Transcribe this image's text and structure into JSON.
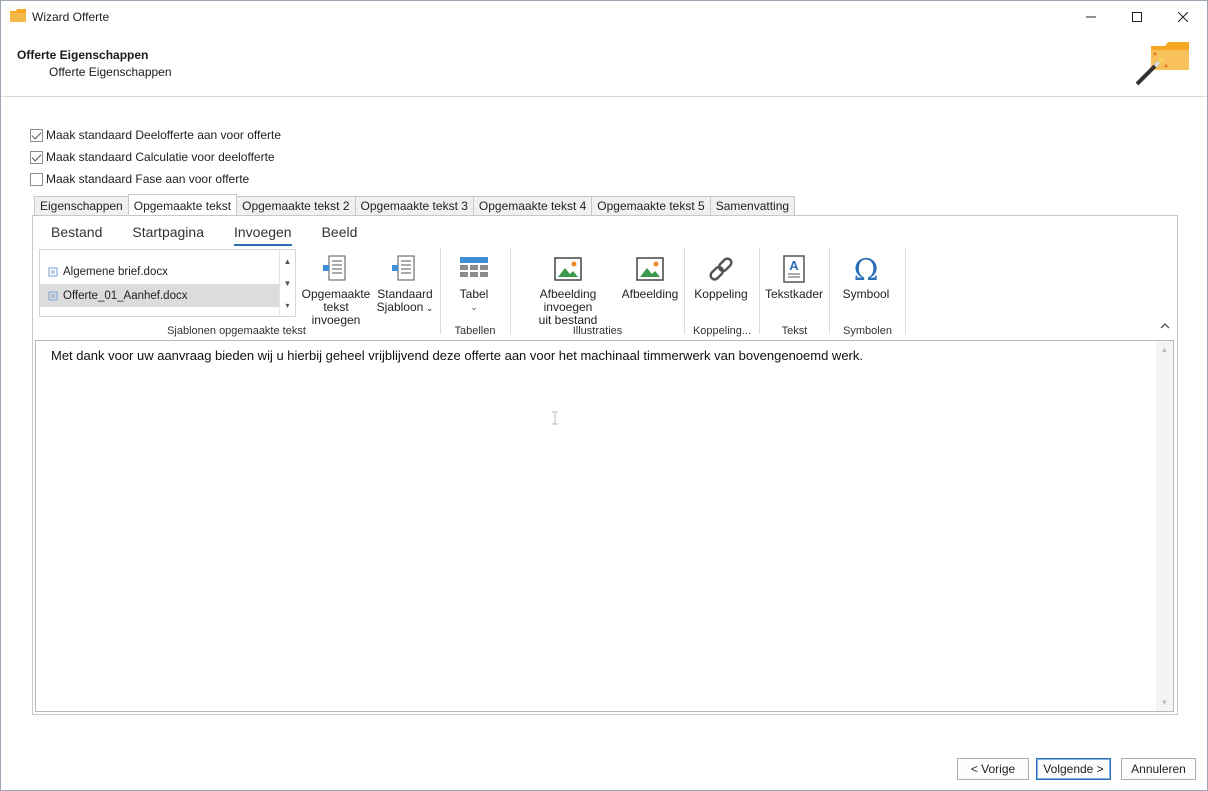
{
  "window": {
    "title": "Wizard Offerte"
  },
  "header": {
    "title": "Offerte Eigenschappen",
    "subtitle": "Offerte Eigenschappen"
  },
  "options": [
    {
      "label": "Maak standaard Deelofferte aan voor offerte",
      "checked": true
    },
    {
      "label": "Maak standaard Calculatie voor deelofferte",
      "checked": true
    },
    {
      "label": "Maak standaard Fase aan voor offerte",
      "checked": false
    }
  ],
  "tabs": [
    {
      "label": "Eigenschappen"
    },
    {
      "label": "Opgemaakte tekst",
      "active": true
    },
    {
      "label": "Opgemaakte tekst 2"
    },
    {
      "label": "Opgemaakte tekst 3"
    },
    {
      "label": "Opgemaakte tekst 4"
    },
    {
      "label": "Opgemaakte tekst 5"
    },
    {
      "label": "Samenvatting"
    }
  ],
  "ribbon": {
    "tabs": [
      "Bestand",
      "Startpagina",
      "Invoegen",
      "Beeld"
    ],
    "active_tab": "Invoegen",
    "templates": {
      "items": [
        "Algemene brief.docx",
        "Offerte_01_Aanhef.docx"
      ],
      "selected": "Offerte_01_Aanhef.docx",
      "group_label": "Sjablonen opgemaakte tekst"
    },
    "buttons": {
      "insert_text_line1": "Opgemaakte",
      "insert_text_line2": "tekst invoegen",
      "std_template_line1": "Standaard",
      "std_template_line2": "Sjabloon",
      "table": "Tabel",
      "image_file_line1": "Afbeelding invoegen",
      "image_file_line2": "uit bestand",
      "image": "Afbeelding",
      "link": "Koppeling",
      "textbox": "Tekstkader",
      "symbol": "Symbool"
    },
    "groups": {
      "tables": "Tabellen",
      "illustrations": "Illustraties",
      "links": "Koppeling...",
      "text": "Tekst",
      "symbols": "Symbolen"
    }
  },
  "editor": {
    "content": "Met dank voor uw aanvraag bieden wij u hierbij geheel vrijblijvend deze offerte aan voor het machinaal timmerwerk van bovengenoemd werk."
  },
  "footer": {
    "prev": "< Vorige",
    "next": "Volgende >",
    "cancel": "Annuleren"
  },
  "colors": {
    "accent": "#2b6fb6",
    "folder": "#f5a623"
  }
}
